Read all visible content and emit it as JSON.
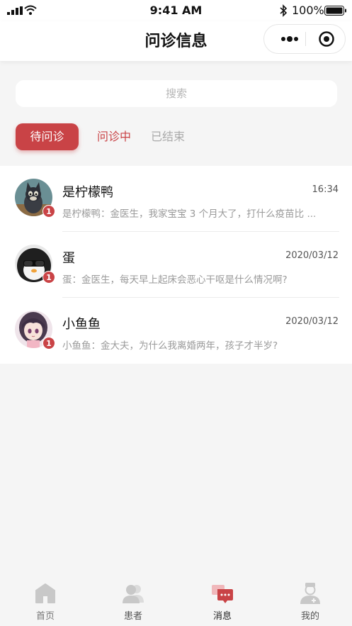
{
  "status_bar": {
    "time": "9:41 AM",
    "battery": "100%"
  },
  "nav": {
    "title": "问诊信息"
  },
  "search": {
    "placeholder": "搜索"
  },
  "tabs": [
    {
      "label": "待问诊",
      "state": "active"
    },
    {
      "label": "问诊中",
      "state": "inactive"
    },
    {
      "label": "已结束",
      "state": "inactive"
    }
  ],
  "consultations": [
    {
      "name": "是柠檬鸭",
      "time": "16:34",
      "message": "是柠檬鸭：金医生，我家宝宝 3 个月大了，打什么疫苗比 ...",
      "unread": "1",
      "avatar": "cat-avatar"
    },
    {
      "name": "蛋",
      "time": "2020/03/12",
      "message": "蛋：金医生，每天早上起床会恶心干呕是什么情况啊?",
      "unread": "1",
      "avatar": "penguin-avatar"
    },
    {
      "name": "小鱼鱼",
      "time": "2020/03/12",
      "message": "小鱼鱼：金大夫，为什么我离婚两年，孩子才半岁?",
      "unread": "1",
      "avatar": "anime-girl-avatar"
    }
  ],
  "tabbar": [
    {
      "label": "首页",
      "icon": "home-icon",
      "active": false
    },
    {
      "label": "患者",
      "icon": "patients-icon",
      "active": false
    },
    {
      "label": "消息",
      "icon": "message-icon",
      "active": true
    },
    {
      "label": "我的",
      "icon": "doctor-icon",
      "active": false
    }
  ],
  "colors": {
    "accent": "#c94346",
    "inactive_icon": "#c8c8c8",
    "background": "#f5f5f5"
  }
}
